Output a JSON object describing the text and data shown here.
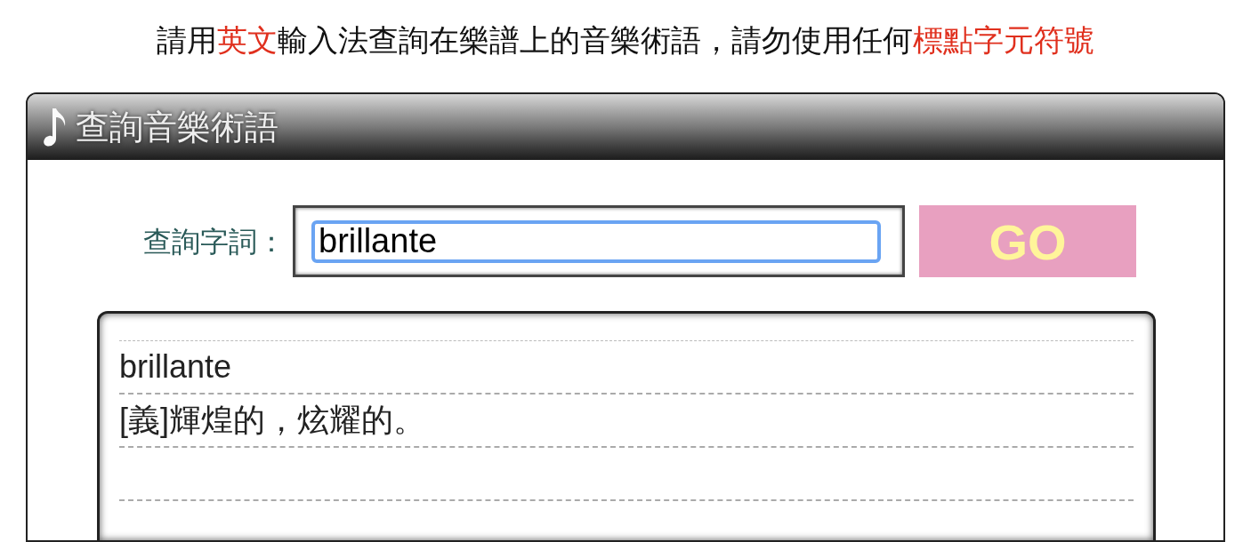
{
  "instruction": [
    {
      "text": "請用",
      "highlight": false
    },
    {
      "text": "英文",
      "highlight": true
    },
    {
      "text": "輸入法查詢在樂譜上的音樂術語，請勿使用任何",
      "highlight": false
    },
    {
      "text": "標點字元符號",
      "highlight": true
    }
  ],
  "panel": {
    "title": "查詢音樂術語"
  },
  "search": {
    "label": "查詢字詞：",
    "value": "brillante",
    "button": "GO"
  },
  "results": [
    "brillante",
    "[義]輝煌的，炫耀的。"
  ]
}
